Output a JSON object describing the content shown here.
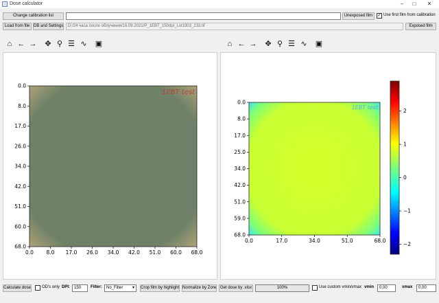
{
  "window": {
    "title": "Dose calculator"
  },
  "row1": {
    "change_calibration_label": "Change calibration list",
    "calibration_path": "",
    "unexposed_label": "Unexposed film",
    "use_first_film_label": "Use first film from calibration",
    "use_first_film_checked": true
  },
  "row2": {
    "load_label": "Load from file",
    "db_label": "DB and Settings",
    "file_path": "D:/24 часа после облучения/16.09.2021/P_1EBT_150dpi_Lot1903_233.tif",
    "exposed_label": "Exposed film"
  },
  "toolbar_icons": [
    "home-icon",
    "back-arrow-icon",
    "forward-arrow-icon",
    "pan-icon",
    "zoom-icon",
    "subplots-icon",
    "edit-curve-icon",
    "save-icon"
  ],
  "left_plot": {
    "x_ticks": [
      "0.0",
      "8.0",
      "17.0",
      "26.0",
      "34.0",
      "42.0",
      "51.0",
      "60.0",
      "68.0"
    ],
    "y_ticks": [
      "0.0",
      "8.0",
      "17.0",
      "26.0",
      "34.0",
      "42.0",
      "51.0",
      "60.0",
      "68.0"
    ],
    "film_label": "1EBT test",
    "film_color": "#6f8268",
    "edge_color": "#b5a578"
  },
  "right_plot": {
    "x_ticks": [
      "0.0",
      "17.0",
      "34.0",
      "51.0",
      "68.0"
    ],
    "y_ticks": [
      "0.0",
      "8.0",
      "17.0",
      "25.0",
      "34.0",
      "42.0",
      "51.0",
      "59.0",
      "68.0"
    ],
    "colorbar_ticks": [
      "2",
      "1",
      "0",
      "−1",
      "−2"
    ],
    "colorbar_range": [
      -2.3,
      2.9
    ],
    "field_color": "#d6ff27",
    "edge_color": "#35e0ff",
    "film_label": "1EBT test"
  },
  "bottom": {
    "calculate_label": "Calculate dose",
    "ods_only_label": "OD's only",
    "dpi_label": "DPI:",
    "dpi_value": "150",
    "filter_label": "Filter:",
    "filter_value": "No_Filter",
    "crop_label": "Crop film by highlight",
    "normalize_label": "Normalize by Zone",
    "get_dose_label": "Get dose by .xlsx",
    "progress_text": "100%",
    "progress_value": 1.0,
    "custom_vminmax_label": "Use custom vmin/vmax",
    "vmin_label": "vmin",
    "vmin_value": "0,00",
    "vmax_label": "vmax",
    "vmax_value": "0,00"
  }
}
